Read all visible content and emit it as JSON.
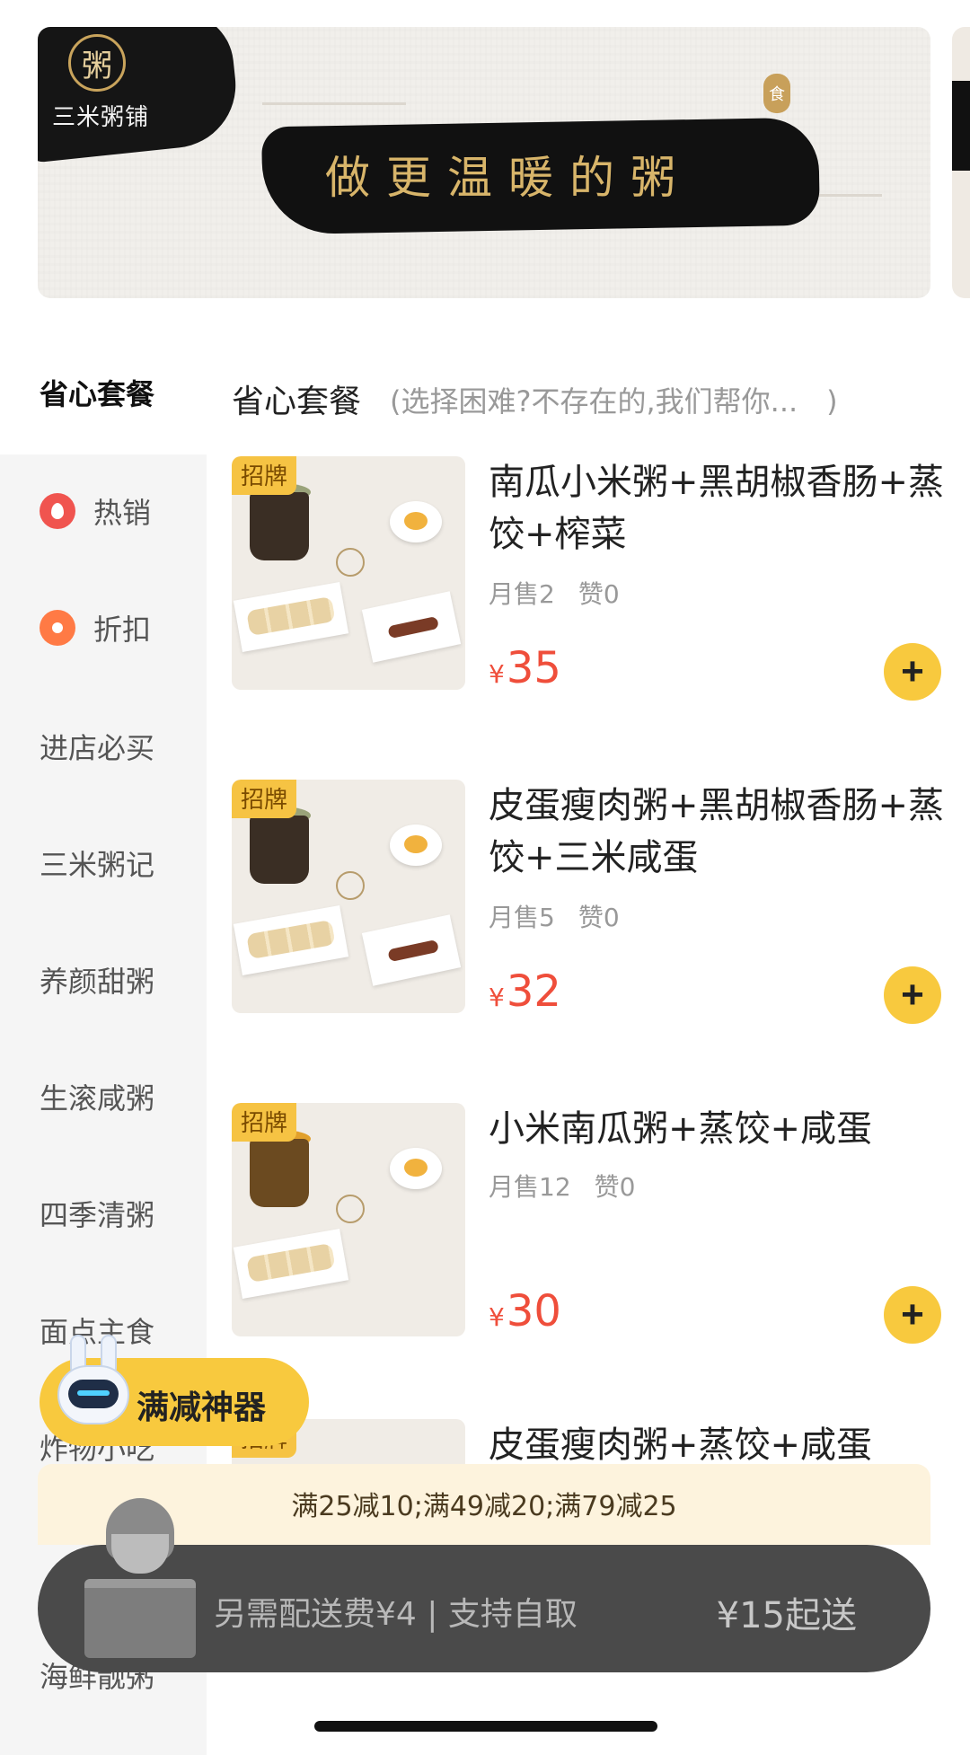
{
  "banner": {
    "logo_char": "粥",
    "logo_text": "三米粥铺",
    "slogan": "做更温暖的粥",
    "seal_char": "食"
  },
  "section": {
    "title": "省心套餐",
    "description": "(选择困难?不存在的,我们帮你...　)"
  },
  "sidebar": {
    "active": "省心套餐",
    "items": [
      {
        "label": "热销",
        "icon": "fire-icon"
      },
      {
        "label": "折扣",
        "icon": "discount-tag-icon"
      },
      {
        "label": "进店必买"
      },
      {
        "label": "三米粥记"
      },
      {
        "label": "养颜甜粥"
      },
      {
        "label": "生滚咸粥"
      },
      {
        "label": "四季清粥"
      },
      {
        "label": "面点主食"
      },
      {
        "label": "炸物小吃"
      },
      {
        "label": "海鲜靓粥"
      }
    ]
  },
  "products": [
    {
      "badge": "招牌",
      "name": "南瓜小米粥+黑胡椒香肠+蒸饺+榨菜",
      "monthly_sales": "月售2",
      "likes": "赞0",
      "currency": "¥",
      "price": "35",
      "add_label": "+"
    },
    {
      "badge": "招牌",
      "name": "皮蛋瘦肉粥+黑胡椒香肠+蒸饺+三米咸蛋",
      "monthly_sales": "月售5",
      "likes": "赞0",
      "currency": "¥",
      "price": "32",
      "add_label": "+"
    },
    {
      "badge": "招牌",
      "name": "小米南瓜粥+蒸饺+咸蛋",
      "monthly_sales": "月售12",
      "likes": "赞0",
      "currency": "¥",
      "price": "30",
      "add_label": "+"
    },
    {
      "badge": "招牌",
      "name": "皮蛋瘦肉粥+蒸饺+咸蛋"
    }
  ],
  "promo": {
    "label": "满减神器",
    "discounts": "满25减10;满49减20;满79减25"
  },
  "cart": {
    "delivery_text": "另需配送费¥4 | 支持自取",
    "min_order": "¥15起送"
  },
  "colors": {
    "accent_yellow": "#f8c93e",
    "price_red": "#ef4e3b",
    "cart_bar": "#4a4a4a"
  }
}
